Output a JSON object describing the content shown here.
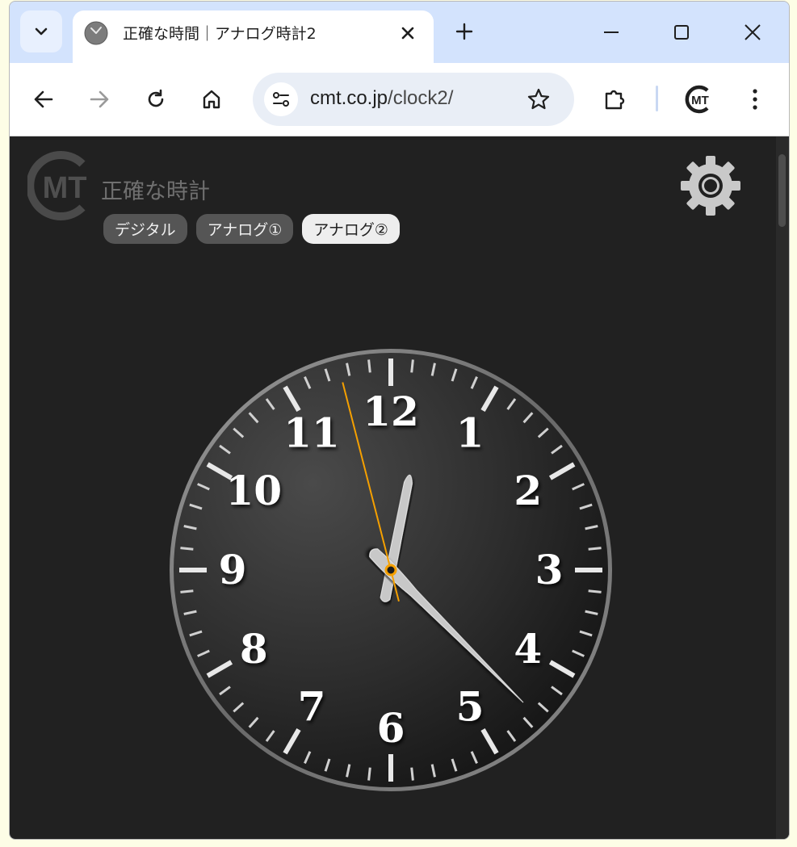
{
  "browser": {
    "tab_title": "正確な時間｜アナログ時計2",
    "url_host": "cmt.co.jp",
    "url_path": "/clock2/",
    "profile_logo_text": "MT"
  },
  "page": {
    "logo_text": "MT",
    "site_title": "正確な時計",
    "nav": [
      {
        "label": "デジタル",
        "active": false
      },
      {
        "label": "アナログ①",
        "active": false
      },
      {
        "label": "アナログ②",
        "active": true
      }
    ]
  },
  "clock": {
    "numerals": [
      "12",
      "1",
      "2",
      "3",
      "4",
      "5",
      "6",
      "7",
      "8",
      "9",
      "10",
      "11"
    ],
    "time": {
      "hour": 12,
      "minute": 22.5,
      "second": 57.6
    },
    "second_hand_color": "#f5a000"
  },
  "colors": {
    "tabstrip": "#d3e3fd",
    "page_bg": "#212121",
    "accent": "#f5a000"
  }
}
